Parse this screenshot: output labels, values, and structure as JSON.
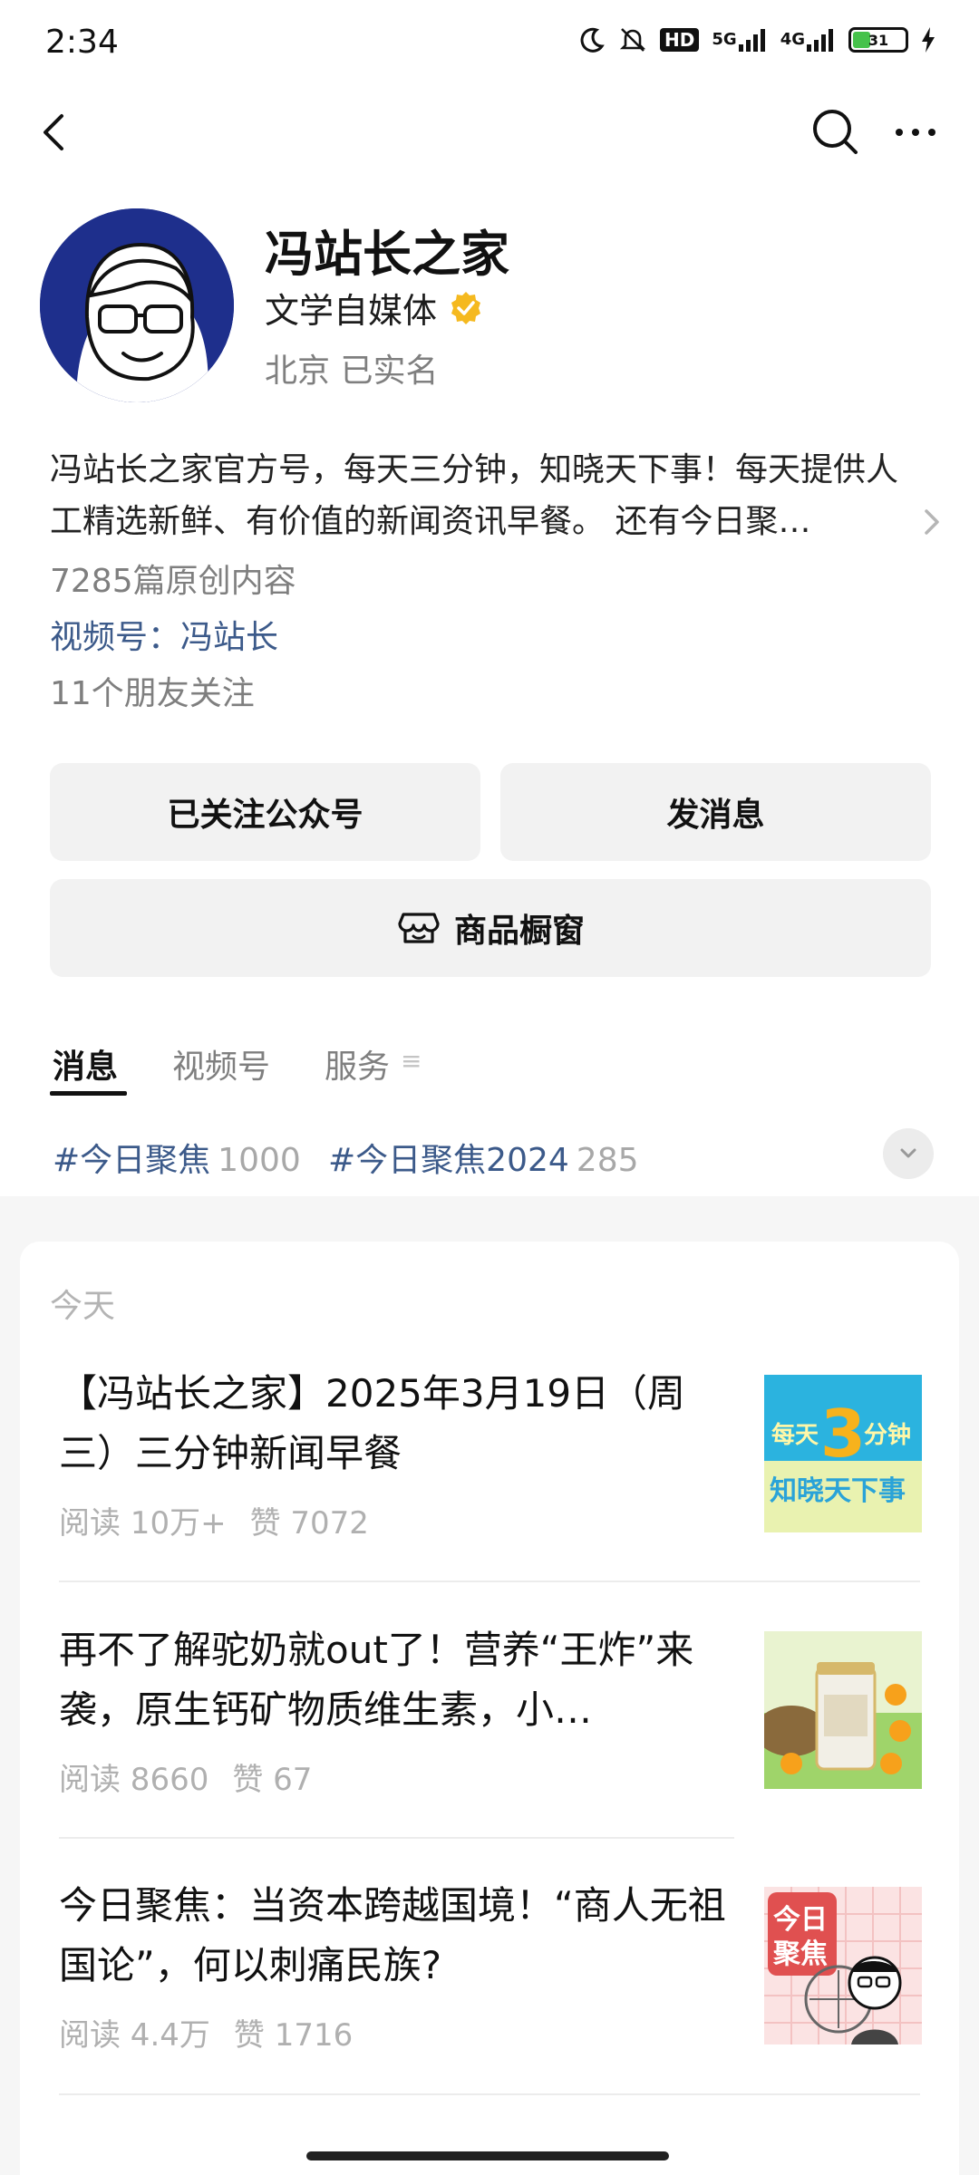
{
  "status_bar": {
    "time": "2:34",
    "hd_label": "HD",
    "net1": "5G",
    "net2": "4G",
    "battery": "31"
  },
  "profile": {
    "name": "冯站长之家",
    "category": "文学自媒体",
    "location": "北京 已实名",
    "description": "冯站长之家官方号，每天三分钟，知晓天下事！每天提供人工精选新鲜、有价值的新闻资讯早餐。 还有今日聚…",
    "original_count": "7285篇原创内容",
    "channel": "视频号：冯站长",
    "friends": "11个朋友关注"
  },
  "actions": {
    "followed": "已关注公众号",
    "message": "发消息",
    "shop": "商品橱窗"
  },
  "tabs": [
    {
      "label": "消息",
      "active": true
    },
    {
      "label": "视频号",
      "active": false
    },
    {
      "label": "服务",
      "active": false
    }
  ],
  "hashtags": [
    {
      "name": "#今日聚焦",
      "count": "1000"
    },
    {
      "name": "#今日聚焦2024",
      "count": "285"
    }
  ],
  "feed": {
    "section_label": "今天",
    "articles": [
      {
        "title": "【冯站长之家】2025年3月19日（周三）三分钟新闻早餐",
        "reads": "阅读 10万+",
        "likes": "赞 7072",
        "thumb_line1": "每天",
        "thumb_num": "3",
        "thumb_unit": "分钟",
        "thumb_line2": "知晓天下事"
      },
      {
        "title": "再不了解驼奶就out了！营养“王炸”来袭，原生钙矿物质维生素，小…",
        "reads": "阅读 8660",
        "likes": "赞 67"
      },
      {
        "title": "今日聚焦：当资本跨越国境！“商人无祖国论”，何以刺痛民族?",
        "reads": "阅读 4.4万",
        "likes": "赞 1716",
        "thumb_line1": "今日",
        "thumb_line2": "聚焦"
      }
    ]
  },
  "colors": {
    "link": "#3c5a8a",
    "avatar_bg": "#1e2f8c",
    "verified": "#f5b91f",
    "button_bg": "#f2f2f2"
  }
}
